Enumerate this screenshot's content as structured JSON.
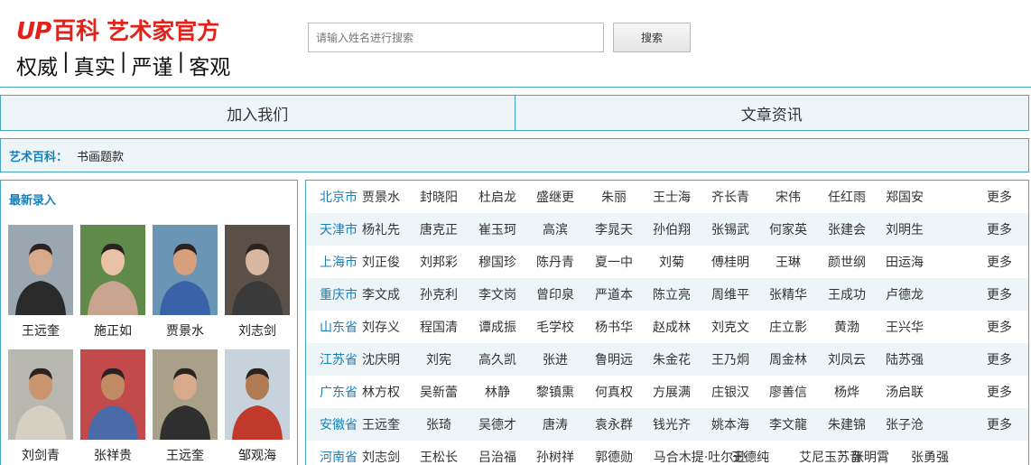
{
  "header": {
    "logo_up": "UP",
    "logo_baike": "百科",
    "logo_official": "艺术家官方",
    "slogan": [
      "权威",
      "真实",
      "严谨",
      "客观"
    ],
    "search_placeholder": "请输入姓名进行搜索",
    "search_button": "搜索"
  },
  "nav": [
    "加入我们",
    "文章资讯"
  ],
  "breadcrumb": {
    "label": "艺术百科：",
    "value": "书画题款"
  },
  "latest": {
    "title": "最新录入",
    "people": [
      {
        "name": "王远奎"
      },
      {
        "name": "施正如"
      },
      {
        "name": "贾景水"
      },
      {
        "name": "刘志剑"
      },
      {
        "name": "刘剑青"
      },
      {
        "name": "张祥贵"
      },
      {
        "name": "王远奎"
      },
      {
        "name": "邹观海"
      }
    ]
  },
  "regions": {
    "more_label": "更多",
    "rows": [
      {
        "region": "北京市",
        "names": [
          "贾景水",
          "封晓阳",
          "杜启龙",
          "盛继更",
          "朱丽",
          "王士海",
          "齐长青",
          "宋伟",
          "任红雨",
          "郑国安"
        ]
      },
      {
        "region": "天津市",
        "names": [
          "杨礼先",
          "唐克正",
          "崔玉珂",
          "高滨",
          "李晁天",
          "孙伯翔",
          "张锡武",
          "何家英",
          "张建会",
          "刘明生"
        ]
      },
      {
        "region": "上海市",
        "names": [
          "刘正俊",
          "刘邦彩",
          "穆国珍",
          "陈丹青",
          "夏一中",
          "刘菊",
          "傅桂明",
          "王琳",
          "颜世纲",
          "田运海"
        ]
      },
      {
        "region": "重庆市",
        "names": [
          "李文成",
          "孙克利",
          "李文岗",
          "曾印泉",
          "严道本",
          "陈立亮",
          "周维平",
          "张精华",
          "王成功",
          "卢德龙"
        ]
      },
      {
        "region": "山东省",
        "names": [
          "刘存义",
          "程国清",
          "谭成振",
          "毛学校",
          "杨书华",
          "赵成林",
          "刘克文",
          "庄立影",
          "黄渤",
          "王兴华"
        ]
      },
      {
        "region": "江苏省",
        "names": [
          "沈庆明",
          "刘宪",
          "高久凯",
          "张进",
          "鲁明远",
          "朱金花",
          "王乃炯",
          "周金林",
          "刘凤云",
          "陆苏强"
        ]
      },
      {
        "region": "广东省",
        "names": [
          "林方权",
          "吴新蕾",
          "林静",
          "黎镇熏",
          "何真权",
          "方展满",
          "庄银汉",
          "廖善信",
          "杨烨",
          "汤启联"
        ]
      },
      {
        "region": "安徽省",
        "names": [
          "王远奎",
          "张琦",
          "吴德才",
          "唐涛",
          "袁永群",
          "钱光齐",
          "姚本海",
          "李文龍",
          "朱建锦",
          "张子沧"
        ]
      },
      {
        "region": "河南省",
        "names": [
          "刘志剑",
          "王松长",
          "吕治福",
          "孙树祥",
          "郭德勋",
          "马合木提·吐尔逊",
          "王德纯",
          "艾尼玉苏音",
          "张明霄",
          "张勇强"
        ]
      }
    ]
  }
}
